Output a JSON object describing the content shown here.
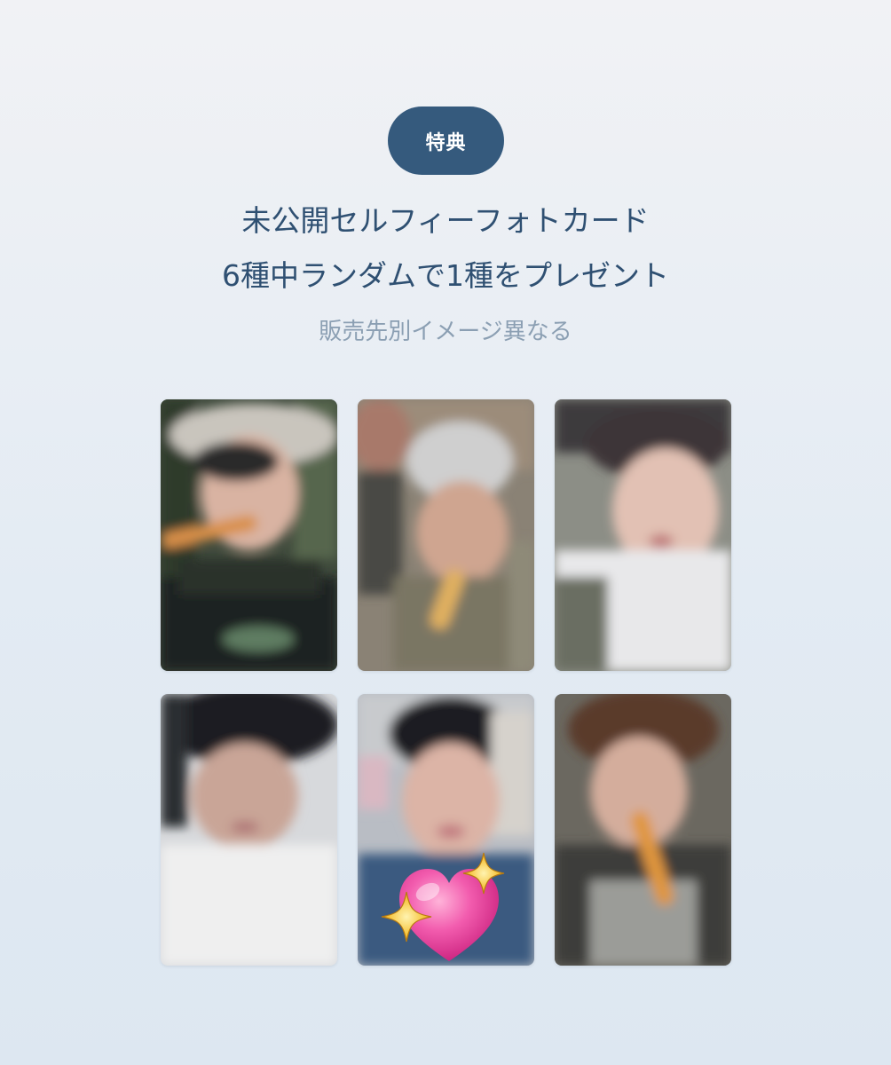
{
  "badge": {
    "label": "特典"
  },
  "headline": {
    "line1": "未公開セルフィーフォトカード",
    "line2": "6種中ランダムで1種をプレゼント"
  },
  "subnote": "販売先別イメージ異なる",
  "photocards": [
    {
      "icon": "blurred-photo",
      "sticker": ""
    },
    {
      "icon": "blurred-photo",
      "sticker": ""
    },
    {
      "icon": "blurred-photo",
      "sticker": ""
    },
    {
      "icon": "blurred-photo",
      "sticker": ""
    },
    {
      "icon": "blurred-photo",
      "sticker": "sparkling-heart-icon"
    },
    {
      "icon": "blurred-photo",
      "sticker": ""
    }
  ],
  "colors": {
    "badge_bg": "#355a7d",
    "headline": "#2f5072",
    "subnote": "#8b9fb3",
    "heart": "#e8489a",
    "sparkle": "#f6c33a"
  }
}
